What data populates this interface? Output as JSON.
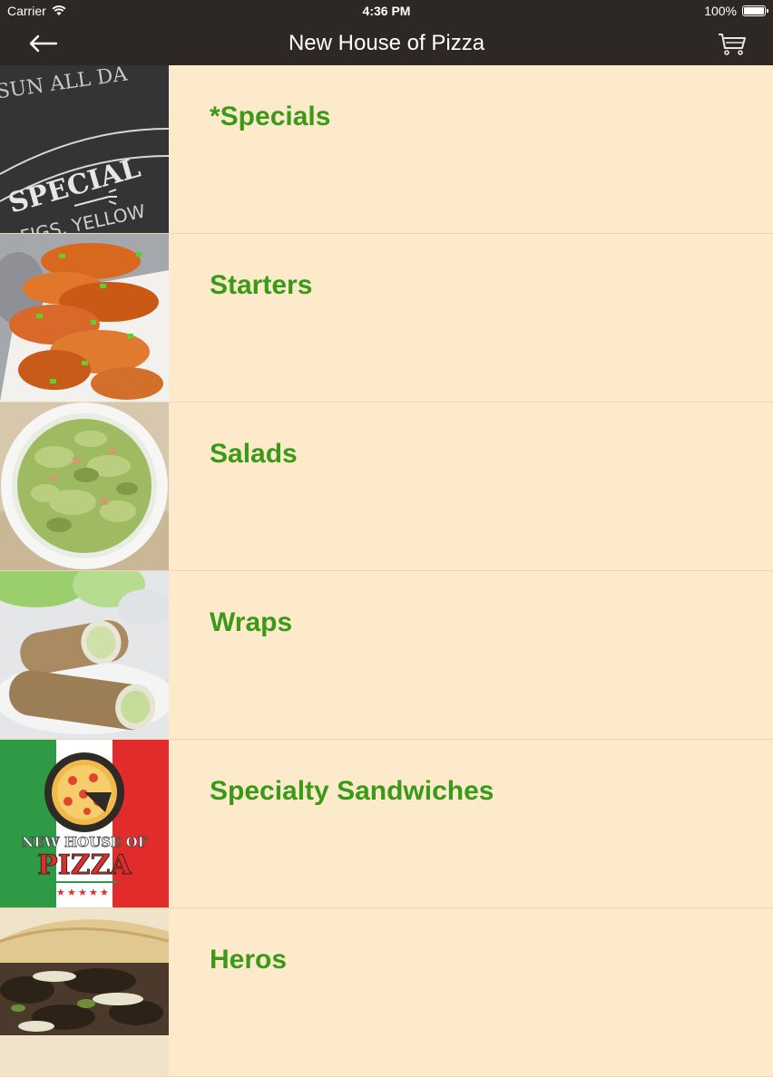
{
  "status_bar": {
    "carrier": "Carrier",
    "time": "4:36 PM",
    "battery": "100%",
    "battery_level": 1.0
  },
  "header": {
    "title": "New House of Pizza",
    "back_icon": "back-arrow-icon",
    "cart_icon": "cart-icon"
  },
  "menu": {
    "items": [
      {
        "label": "*Specials",
        "image": "specials-chalkboard-image"
      },
      {
        "label": "Starters",
        "image": "chicken-wings-image"
      },
      {
        "label": "Salads",
        "image": "salad-bowl-image"
      },
      {
        "label": "Wraps",
        "image": "wraps-image"
      },
      {
        "label": "Specialty Sandwiches",
        "image": "house-logo-image"
      },
      {
        "label": "Heros",
        "image": "hero-sandwich-image"
      }
    ]
  },
  "logo_text": {
    "line1": "NEW HOUSE OF",
    "line2": "PIZZA"
  },
  "chalkboard_text": {
    "top": "SUN ALL DA",
    "main": "SPECIAL",
    "bottom": "FIGS, YELLOW"
  },
  "colors": {
    "bar": "#2e2825",
    "background": "#fdeacb",
    "label": "#3a9a17",
    "divider": "#e8d6b6"
  }
}
